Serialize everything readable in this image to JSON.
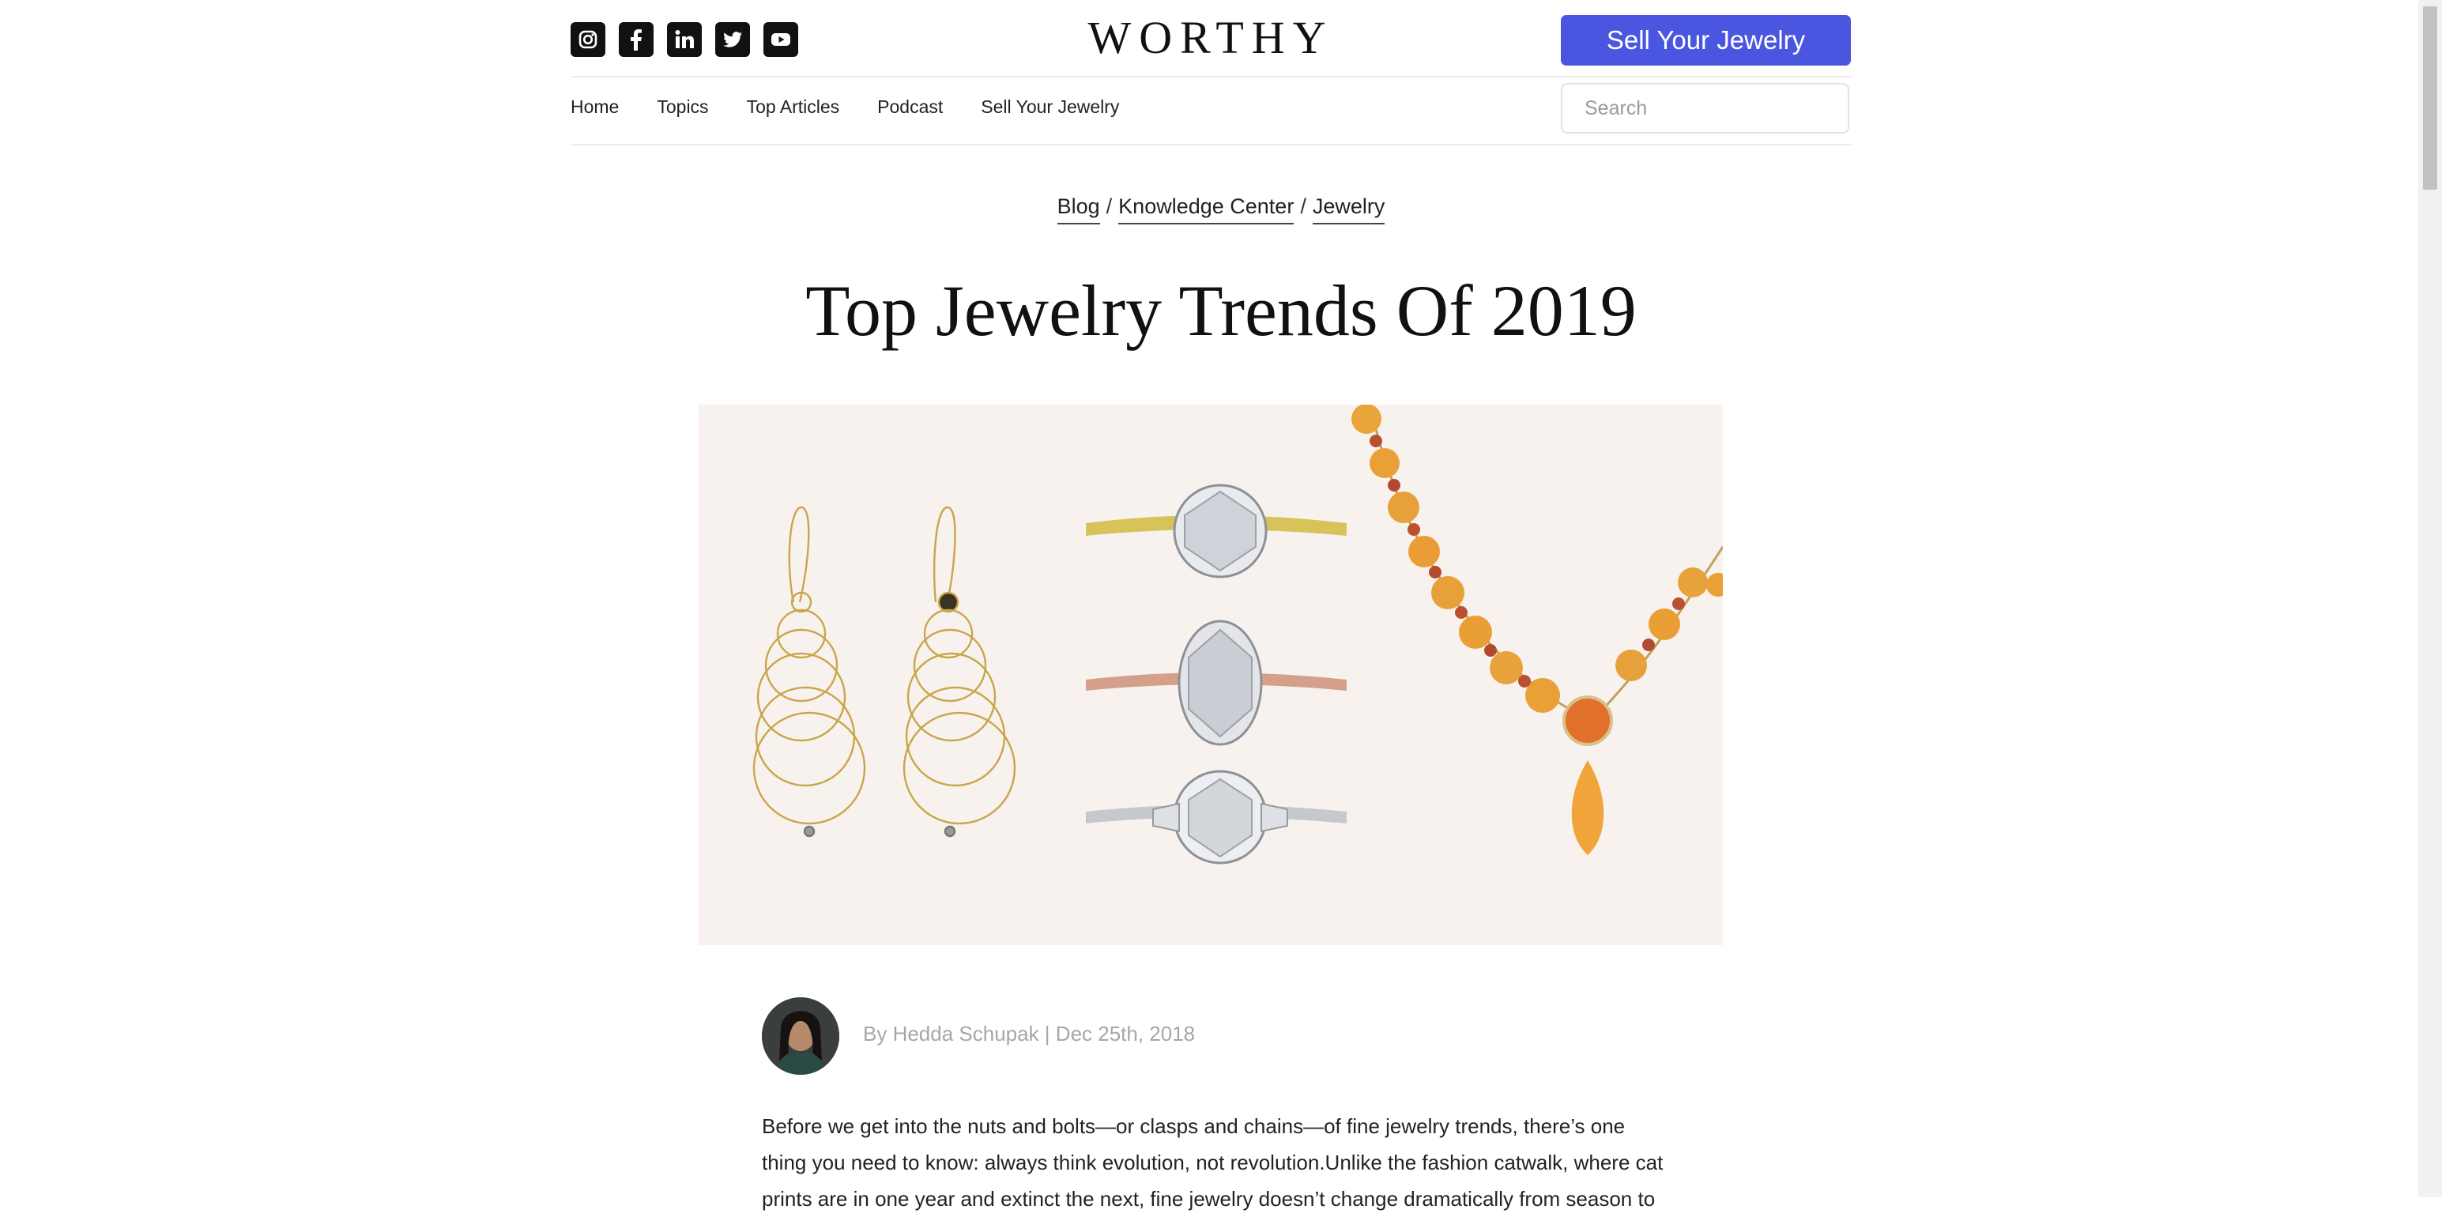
{
  "header": {
    "logo_text": "WORTHY",
    "cta_label": "Sell Your Jewelry",
    "accent_color": "#4a55e0",
    "social": [
      {
        "icon": "instagram-icon"
      },
      {
        "icon": "facebook-icon"
      },
      {
        "icon": "linkedin-icon"
      },
      {
        "icon": "twitter-icon"
      },
      {
        "icon": "youtube-icon"
      }
    ]
  },
  "nav": {
    "items": [
      "Home",
      "Topics",
      "Top Articles",
      "Podcast",
      "Sell Your Jewelry"
    ]
  },
  "search": {
    "placeholder": "Search",
    "icon": "search-icon"
  },
  "breadcrumb": {
    "items": [
      "Blog",
      "Knowledge Center",
      "Jewelry"
    ],
    "separator": "/"
  },
  "article": {
    "title": "Top Jewelry Trends Of 2019",
    "byline": "By Hedda Schupak | Dec 25th, 2018",
    "body": "Before we get into the nuts and bolts—or clasps and chains—of fine jewelry trends, there’s one thing you need to know: always think evolution, not revolution.Unlike the fashion catwalk, where cat prints are in one year and extinct the next, fine jewelry doesn’t change dramatically from season to"
  }
}
